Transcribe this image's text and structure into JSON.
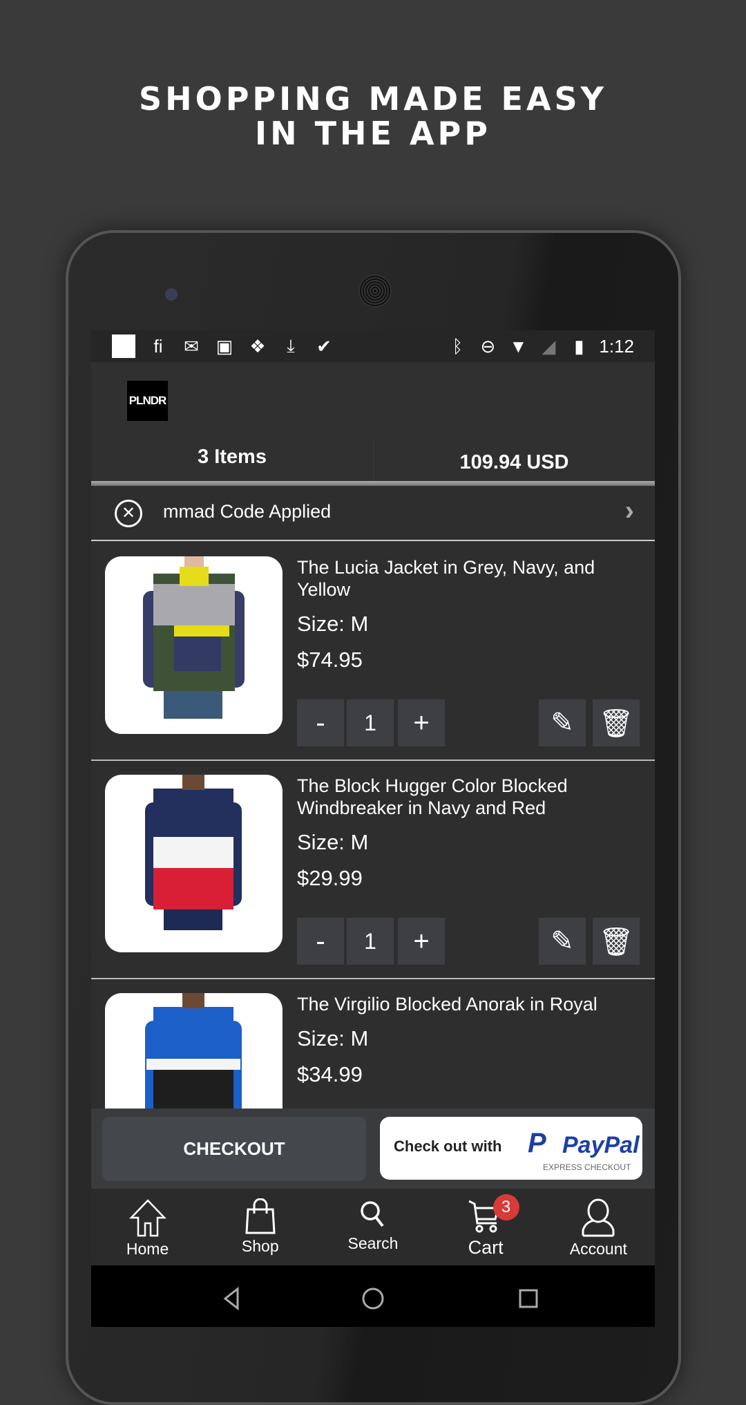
{
  "headline": {
    "line1": "SHOPPING MADE EASY",
    "line2": "IN THE APP"
  },
  "status_bar": {
    "time": "1:12",
    "left_icons": [
      "square-icon",
      "fi-icon",
      "gmail-icon",
      "image-icon",
      "dropbox-icon",
      "download-icon",
      "check-icon"
    ],
    "right_icons": [
      "bluetooth-icon",
      "dnd-icon",
      "wifi-icon",
      "signal-icon",
      "battery-icon"
    ]
  },
  "header": {
    "logo": "PLNDR",
    "items_count": "3 Items",
    "total": "109.94 USD"
  },
  "promo": {
    "text": "mmad Code Applied"
  },
  "cart_items": [
    {
      "title": "The Lucia Jacket in Grey, Navy, and Yellow",
      "size": "Size: M",
      "price": "$74.95",
      "qty": "1"
    },
    {
      "title": "The Block Hugger Color Blocked Windbreaker in Navy and Red",
      "size": "Size: M",
      "price": "$29.99",
      "qty": "1"
    },
    {
      "title": "The Virgilio Blocked Anorak in Royal",
      "size": "Size: M",
      "price": "$34.99"
    }
  ],
  "buttons": {
    "minus": "-",
    "plus": "+",
    "checkout": "CHECKOUT",
    "paypal_prefix": "Check out with",
    "paypal_brand": "PayPal",
    "paypal_sub": "EXPRESS CHECKOUT"
  },
  "nav": [
    {
      "label": "Home"
    },
    {
      "label": "Shop"
    },
    {
      "label": "Search"
    },
    {
      "label": "Cart",
      "badge": "3"
    },
    {
      "label": "Account"
    }
  ],
  "colors": {
    "badge": "#d93a3a",
    "paypal_blue": "#1c3fa8",
    "screen_bg": "#2e2e2e"
  }
}
